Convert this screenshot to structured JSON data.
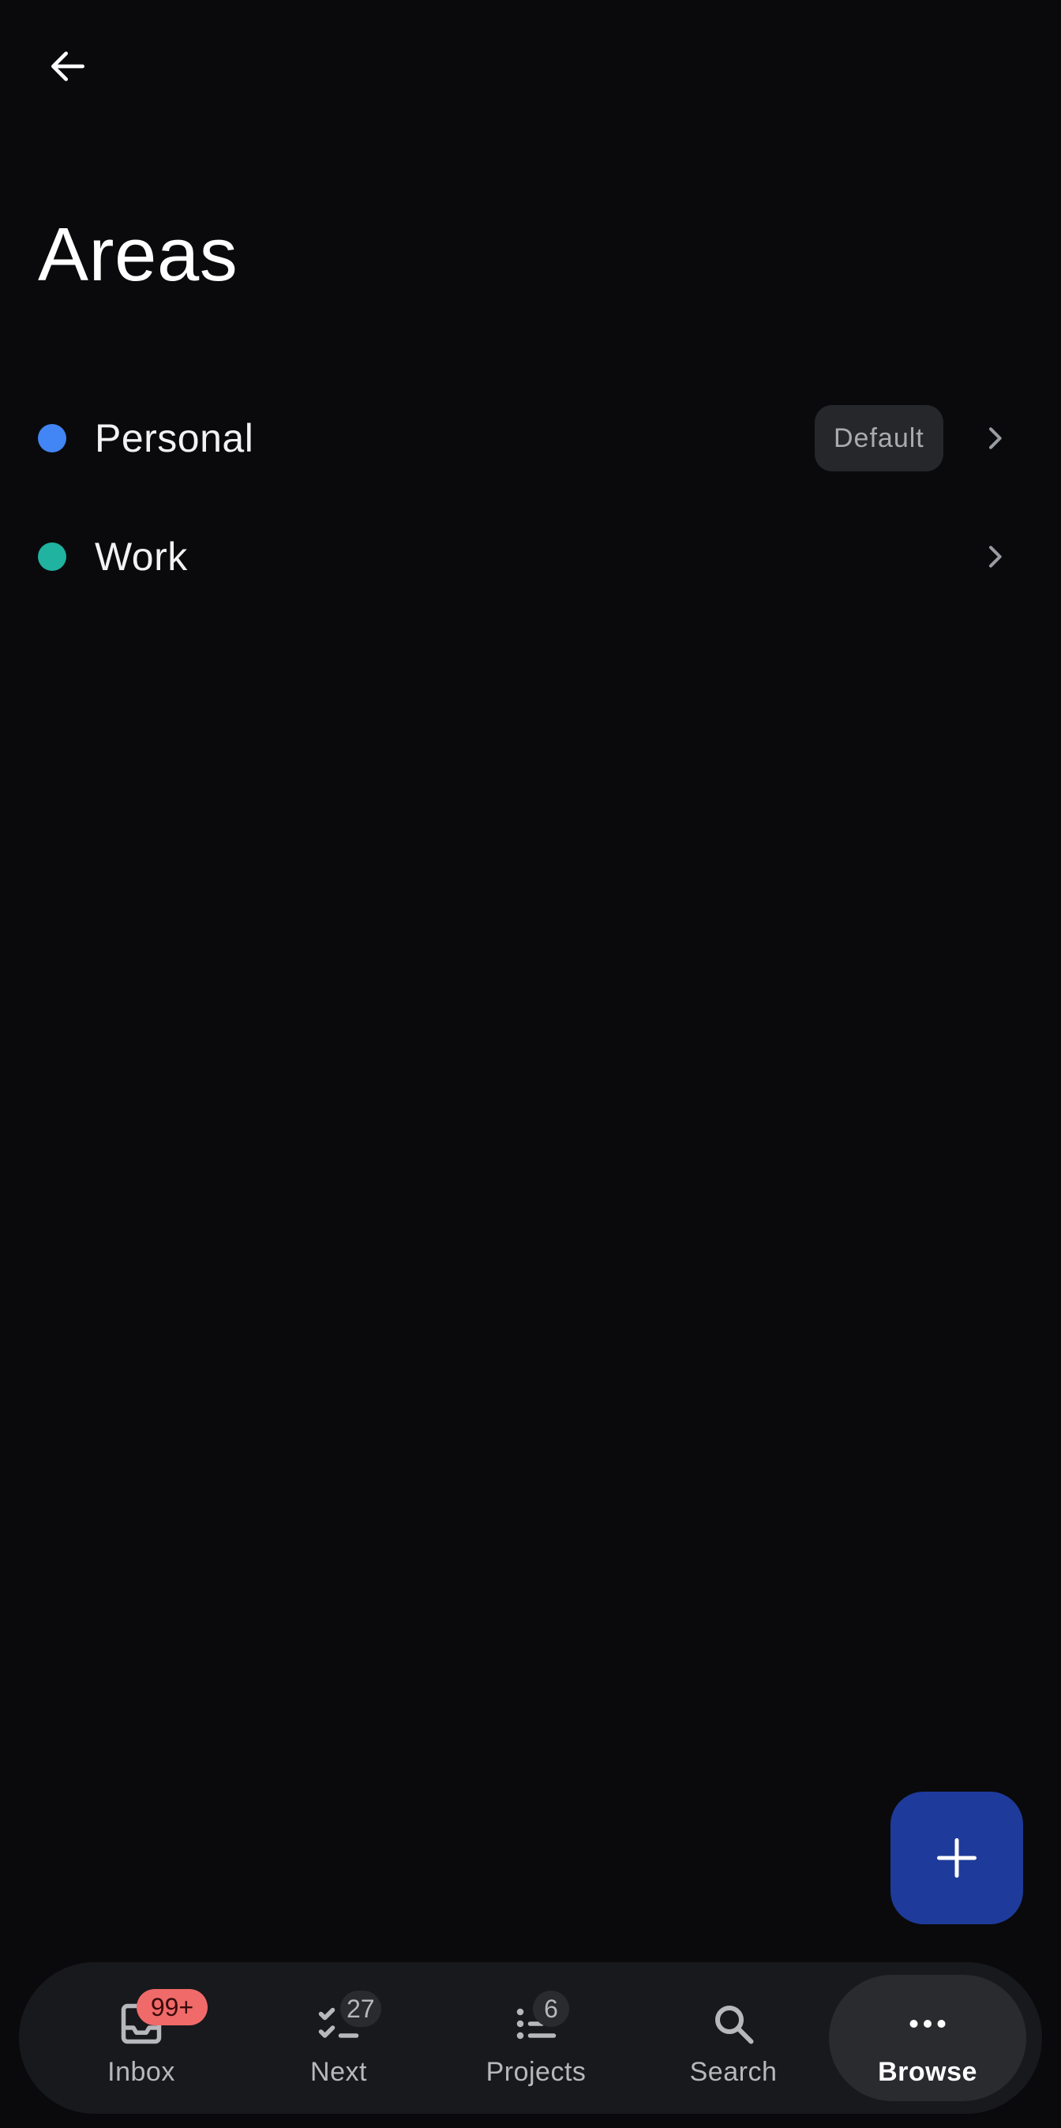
{
  "header": {
    "back_icon": "arrow-left-icon",
    "title": "Areas"
  },
  "areas": [
    {
      "label": "Personal",
      "color": "#4285f4",
      "badge": "Default"
    },
    {
      "label": "Work",
      "color": "#1fb3a0",
      "badge": ""
    }
  ],
  "fab": {
    "icon": "plus-icon",
    "color": "#1e3a9a"
  },
  "nav": {
    "items": [
      {
        "label": "Inbox",
        "icon": "inbox-icon",
        "badge": "99+"
      },
      {
        "label": "Next",
        "icon": "checklist-icon",
        "badge": "27"
      },
      {
        "label": "Projects",
        "icon": "list-icon",
        "badge": "6"
      },
      {
        "label": "Search",
        "icon": "search-icon",
        "badge": ""
      },
      {
        "label": "Browse",
        "icon": "more-horizontal-icon",
        "badge": ""
      }
    ],
    "active": "Browse"
  },
  "colors": {
    "background": "#0a0a0c",
    "badge_red": "#f06a6a"
  }
}
